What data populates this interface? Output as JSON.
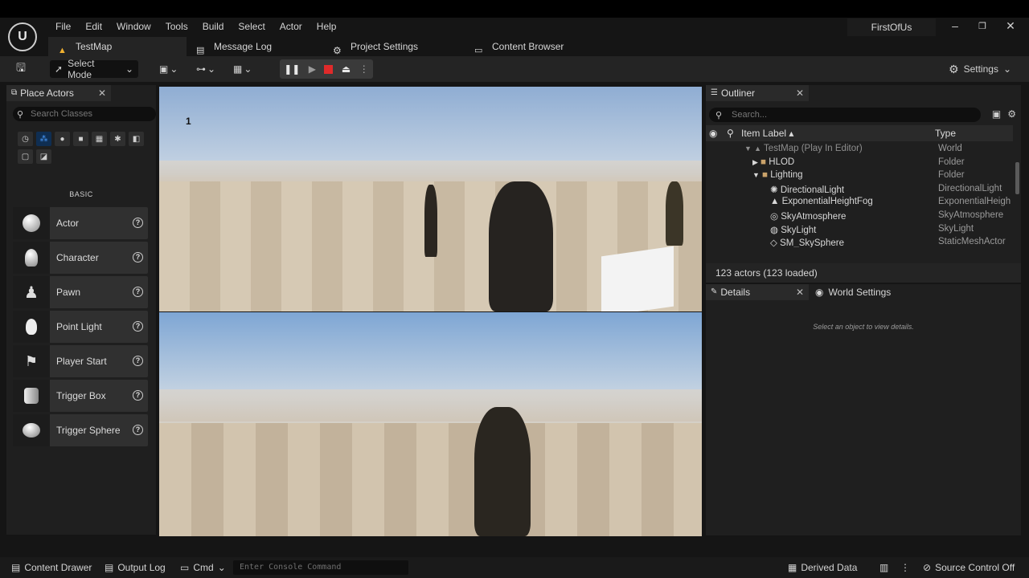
{
  "app": {
    "project_name": "FirstOfUs",
    "menu": [
      "File",
      "Edit",
      "Window",
      "Tools",
      "Build",
      "Select",
      "Actor",
      "Help"
    ]
  },
  "tabs": [
    {
      "label": "TestMap"
    },
    {
      "label": "Message Log"
    },
    {
      "label": "Project Settings"
    },
    {
      "label": "Content Browser"
    }
  ],
  "toolbar": {
    "select_mode": "Select Mode",
    "settings": "Settings"
  },
  "place_actors": {
    "title": "Place Actors",
    "search_placeholder": "Search Classes",
    "category_label": "BASIC",
    "items": [
      {
        "label": "Actor",
        "icon": "sphere-icon"
      },
      {
        "label": "Character",
        "icon": "character-icon"
      },
      {
        "label": "Pawn",
        "icon": "pawn-icon"
      },
      {
        "label": "Point Light",
        "icon": "lightbulb-icon"
      },
      {
        "label": "Player Start",
        "icon": "flag-gamepad-icon"
      },
      {
        "label": "Trigger Box",
        "icon": "cube-icon"
      },
      {
        "label": "Trigger Sphere",
        "icon": "sphere-icon"
      }
    ]
  },
  "viewport": {
    "index_label": "1"
  },
  "outliner": {
    "title": "Outliner",
    "search_placeholder": "Search...",
    "col_label": "Item Label ▴",
    "col_type": "Type",
    "rows": [
      {
        "name": "TestMap (Play In Editor)",
        "type": "World",
        "depth": 0,
        "dim": true
      },
      {
        "name": "HLOD",
        "type": "Folder",
        "depth": 1,
        "dim": false
      },
      {
        "name": "Lighting",
        "type": "Folder",
        "depth": 1,
        "dim": false
      },
      {
        "name": "DirectionalLight",
        "type": "DirectionalLight",
        "depth": 2,
        "dim": false
      },
      {
        "name": "ExponentialHeightFog",
        "type": "ExponentialHeightFog",
        "depth": 2,
        "dim": false
      },
      {
        "name": "SkyAtmosphere",
        "type": "SkyAtmosphere",
        "depth": 2,
        "dim": false
      },
      {
        "name": "SkyLight",
        "type": "SkyLight",
        "depth": 2,
        "dim": false
      },
      {
        "name": "SM_SkySphere",
        "type": "StaticMeshActor",
        "depth": 2,
        "dim": false
      }
    ],
    "footer": "123 actors (123 loaded)"
  },
  "details": {
    "title": "Details",
    "world_settings": "World Settings",
    "empty_text": "Select an object to view details."
  },
  "statusbar": {
    "content_drawer": "Content Drawer",
    "output_log": "Output Log",
    "cmd": "Cmd",
    "console_placeholder": "Enter Console Command",
    "derived_data": "Derived Data",
    "source_control": "Source Control Off"
  }
}
